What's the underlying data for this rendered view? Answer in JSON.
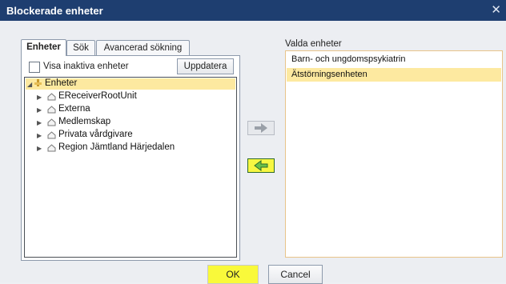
{
  "window": {
    "title": "Blockerade enheter",
    "close_glyph": "✕"
  },
  "tabs": [
    "Enheter",
    "Sök",
    "Avancerad sökning"
  ],
  "filter": {
    "checkbox_label": "Visa inaktiva enheter",
    "checked": false,
    "update_button": "Uppdatera"
  },
  "tree": {
    "root": "Enheter",
    "children": [
      "EReceiverRootUnit",
      "Externa",
      "Medlemskap",
      "Privata vårdgivare",
      "Region Jämtland Härjedalen"
    ]
  },
  "selected": {
    "label": "Valda enheter",
    "items": [
      "Barn- och ungdomspsykiatrin",
      "Ätstörningsenheten"
    ]
  },
  "buttons": {
    "ok": "OK",
    "cancel": "Cancel"
  },
  "colors": {
    "titlebar": "#1e3e70",
    "selection": "#fde9a0",
    "highlight": "#f7f742"
  }
}
